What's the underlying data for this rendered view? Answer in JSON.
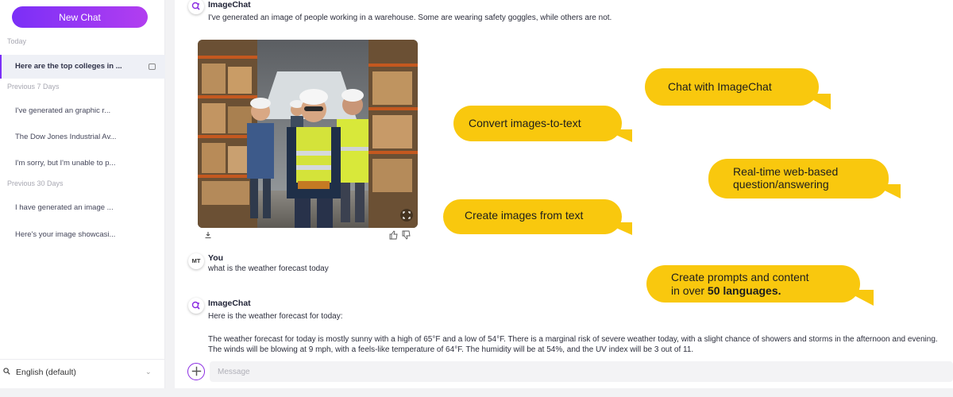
{
  "sidebar": {
    "new_chat_label": "New Chat",
    "sections": [
      {
        "label": "Today"
      },
      {
        "label": "Previous 7 Days"
      },
      {
        "label": "Previous 30 Days"
      }
    ],
    "items": [
      {
        "label": "Here are the top colleges in ..."
      },
      {
        "label": "I've generated an graphic r..."
      },
      {
        "label": "The Dow Jones Industrial Av..."
      },
      {
        "label": "I'm sorry, but I'm unable to p..."
      },
      {
        "label": "I have generated an image ..."
      },
      {
        "label": "Here's your image showcasi..."
      }
    ],
    "language": "English (default)"
  },
  "chat": {
    "msg1": {
      "sender": "ImageChat",
      "text": "I've generated an image of people working in a warehouse. Some are wearing safety goggles, while others are not."
    },
    "msg2": {
      "avatar_initials": "MT",
      "sender": "You",
      "text": "what is the weather forecast today"
    },
    "msg3": {
      "sender": "ImageChat",
      "intro": "Here is the weather forecast for today:",
      "body": "The weather forecast for today is mostly sunny with a high of 65°F and a low of 54°F. There is a marginal risk of severe weather today, with a slight chance of showers and storms in the afternoon and evening. The winds will be blowing at 9 mph, with a feels-like temperature of 64°F. The humidity will be at 54%, and the UV index will be 3 out of 11."
    },
    "input_placeholder": "Message"
  },
  "callouts": {
    "chat": "Chat with ImageChat",
    "convert": "Convert images-to-text",
    "realtime_line1": "Real-time web-based",
    "realtime_line2": "question/answering",
    "create_images": "Create images from text",
    "prompts_line1": "Create prompts and content",
    "prompts_line2_prefix": "in over ",
    "prompts_line2_bold": "50 languages."
  },
  "colors": {
    "accent": "#8a2be2",
    "callout": "#f9c80e"
  }
}
